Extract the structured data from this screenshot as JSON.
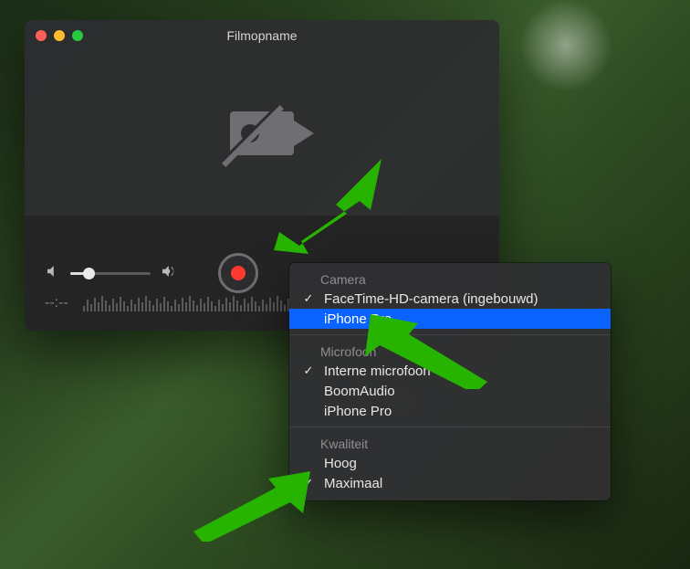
{
  "window": {
    "title": "Filmopname",
    "time_placeholder": "--:--"
  },
  "menu": {
    "camera": {
      "header": "Camera",
      "items": [
        {
          "label": "FaceTime-HD-camera (ingebouwd)",
          "checked": true,
          "highlight": false
        },
        {
          "label": "iPhone Pro",
          "checked": false,
          "highlight": true
        }
      ]
    },
    "microphone": {
      "header": "Microfoon",
      "items": [
        {
          "label": "Interne microfoon",
          "checked": true,
          "highlight": false
        },
        {
          "label": "BoomAudio",
          "checked": false,
          "highlight": false
        },
        {
          "label": "iPhone Pro",
          "checked": false,
          "highlight": false
        }
      ]
    },
    "quality": {
      "header": "Kwaliteit",
      "items": [
        {
          "label": "Hoog",
          "checked": false,
          "highlight": false
        },
        {
          "label": "Maximaal",
          "checked": true,
          "highlight": false
        }
      ]
    }
  }
}
